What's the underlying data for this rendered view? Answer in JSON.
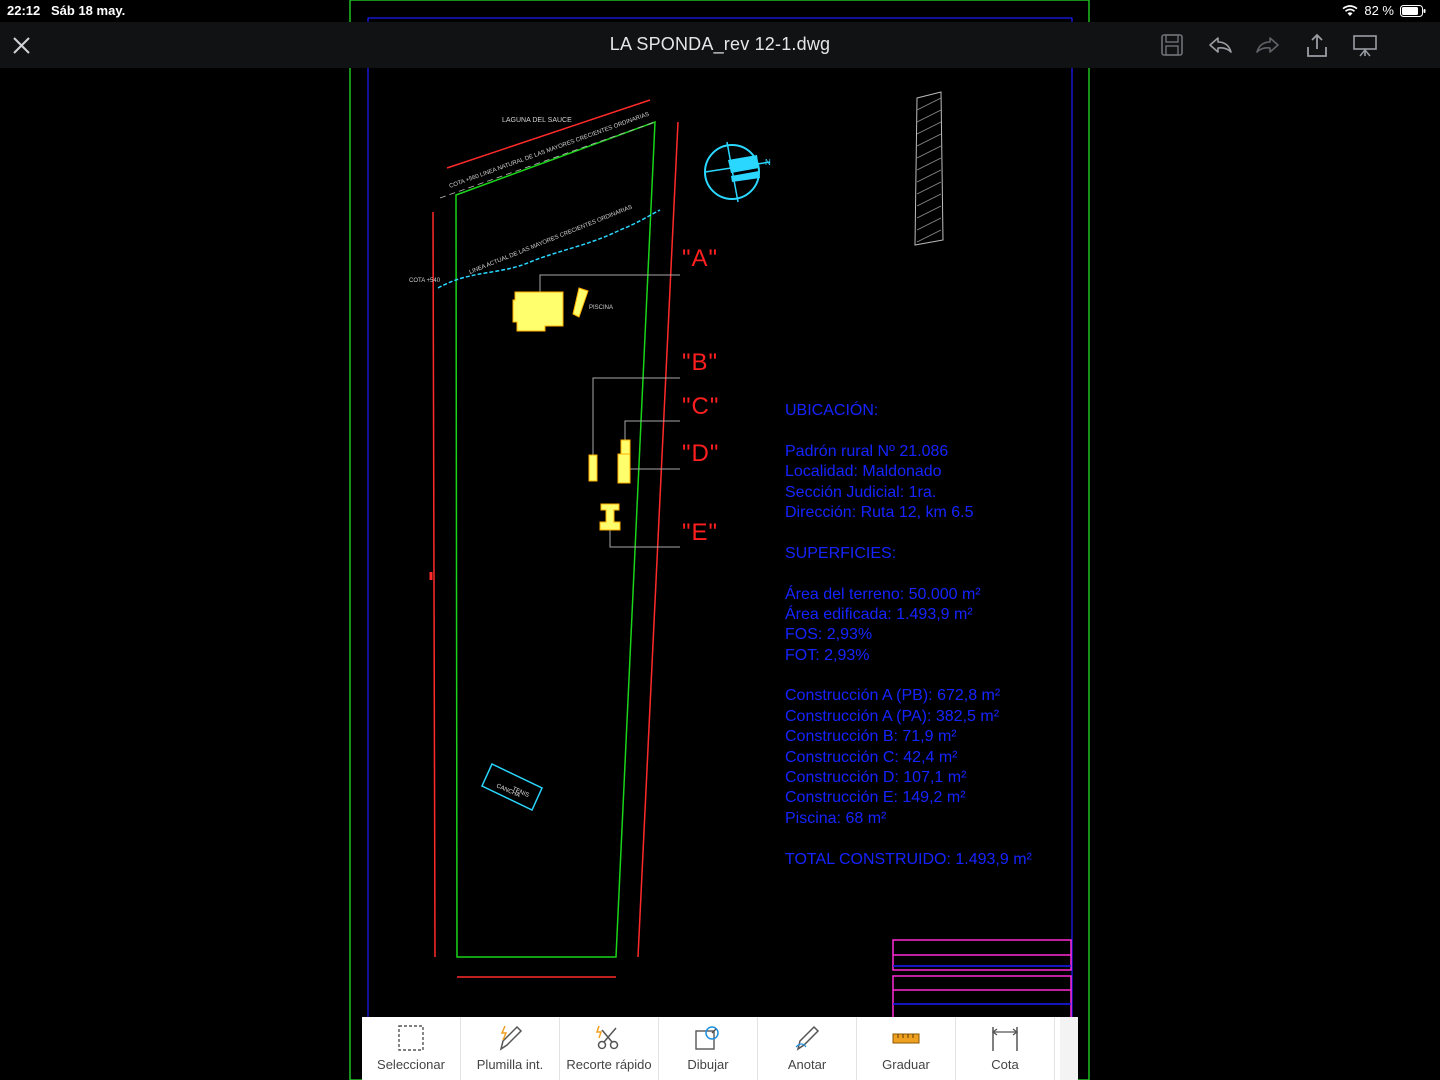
{
  "status": {
    "time": "22:12",
    "date": "Sáb 18 may.",
    "battery": "82 %"
  },
  "header": {
    "title": "LA SPONDA_rev 12-1.dwg",
    "menu_color": "#1d8fe0"
  },
  "drawing": {
    "labels": {
      "a": "\"A\"",
      "b": "\"B\"",
      "c": "\"C\"",
      "d": "\"D\"",
      "e": "\"E\""
    },
    "small_texts": {
      "laguna": "LAGUNA DEL SAUCE",
      "top_line": "COTA +560 LINEA NATURAL DE LAS MAYORES CRECIENTES ORDINARIAS",
      "mid_line": "LINEA ACTUAL DE LAS MAYORES CRECIENTES ORDINARIAS",
      "cota": "COTA +540",
      "piscina": "PISCINA",
      "cancha": "CANCHA",
      "tenis": "TENIS"
    },
    "info_lines": [
      "UBICACIÓN:",
      "",
      "Padrón rural Nº 21.086",
      "Localidad: Maldonado",
      "Sección Judicial: 1ra.",
      "Dirección: Ruta 12, km 6.5",
      "",
      "SUPERFICIES:",
      "",
      "Área del terreno: 50.000 m²",
      "Área edificada: 1.493,9 m²",
      "FOS: 2,93%",
      "FOT: 2,93%",
      "",
      "Construcción A (PB): 672,8 m²",
      "Construcción A (PA): 382,5 m²",
      "Construcción B: 71,9 m²",
      "Construcción C: 42,4 m²",
      "Construcción D: 107,1 m²",
      "Construcción E: 149,2 m²",
      "Piscina: 68 m²",
      "",
      "TOTAL CONSTRUIDO: 1.493,9 m²"
    ],
    "colors": {
      "lot": "#19d419",
      "boundary": "#ff2a2a",
      "buildings": "#ffff6e",
      "info": "#1524ff",
      "frame": "#1a1aff"
    }
  },
  "toolbar": {
    "items": [
      {
        "label": "Seleccionar",
        "icon": "select-icon"
      },
      {
        "label": "Plumilla int.",
        "icon": "smart-pen-icon"
      },
      {
        "label": "Recorte rápido",
        "icon": "quick-trim-icon"
      },
      {
        "label": "Dibujar",
        "icon": "draw-icon"
      },
      {
        "label": "Anotar",
        "icon": "annotate-icon"
      },
      {
        "label": "Graduar",
        "icon": "measure-icon"
      },
      {
        "label": "Cota",
        "icon": "dimension-icon"
      }
    ]
  }
}
